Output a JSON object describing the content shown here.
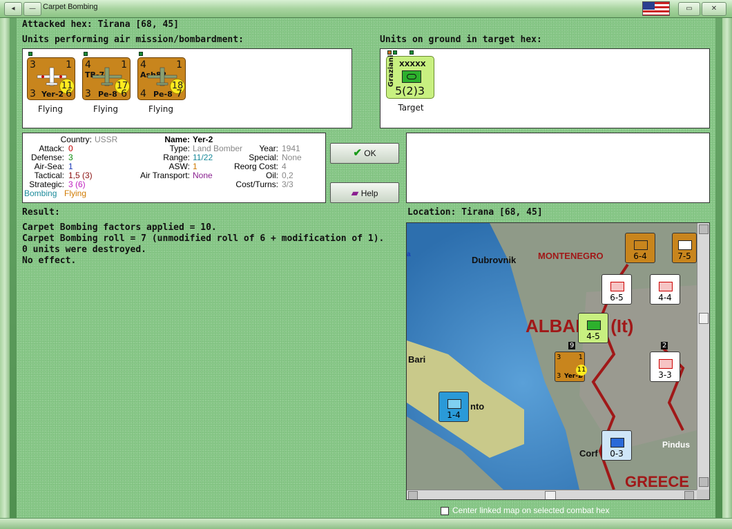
{
  "window": {
    "title": "Carpet Bombing"
  },
  "header": {
    "attacked_hex": "Attacked hex: Tirana [68, 45]",
    "air_units_label": "Units performing air mission/bombardment:",
    "ground_units_label": "Units on ground in target hex:"
  },
  "air_units": [
    {
      "attack": "3",
      "defense": "1",
      "name": "Yer-2",
      "range": "11",
      "tactical": "3",
      "strategic": "6",
      "subname": "",
      "status": "Flying"
    },
    {
      "attack": "4",
      "defense": "1",
      "name": "Pe-8",
      "range": "17",
      "tactical": "3",
      "strategic": "6",
      "subname": "TB-7",
      "status": "Flying"
    },
    {
      "attack": "4",
      "defense": "1",
      "name": "Pe-8",
      "range": "18",
      "tactical": "4",
      "strategic": "7",
      "subname": "Ash82",
      "status": "Flying"
    }
  ],
  "ground_units": [
    {
      "commander": "Graziani",
      "size": "XXXXX",
      "value": "5(2)3",
      "status": "Target"
    }
  ],
  "unit_info": {
    "country_label": "Country:",
    "country": "USSR",
    "attack_label": "Attack:",
    "attack": "0",
    "defense_label": "Defense:",
    "defense": "3",
    "airsea_label": "Air-Sea:",
    "airsea": "1",
    "tactical_label": "Tactical:",
    "tactical": "1,5 (3)",
    "strategic_label": "Strategic:",
    "strategic": "3 (6)",
    "mission": "Bombing",
    "status": "Flying",
    "name_label": "Name:",
    "name": "Yer-2",
    "type_label": "Type:",
    "type": "Land Bomber",
    "range_label": "Range:",
    "range": "11/22",
    "asw_label": "ASW:",
    "asw": "1",
    "air_transport_label": "Air Transport:",
    "air_transport": "None",
    "year_label": "Year:",
    "year": "1941",
    "special_label": "Special:",
    "special": "None",
    "reorg_label": "Reorg Cost:",
    "reorg": "4",
    "oil_label": "Oil:",
    "oil": "0,2",
    "cost_label": "Cost/Turns:",
    "cost": "3/3"
  },
  "buttons": {
    "ok": "OK",
    "help": "Help"
  },
  "result": {
    "label": "Result:",
    "lines": [
      "Carpet Bombing factors applied = 10.",
      "Carpet Bombing roll = 7 (unmodified roll of 6 + modification of 1).",
      "0 units were destroyed.",
      "No effect."
    ]
  },
  "location": {
    "label": "Location: Tirana [68, 45]"
  },
  "map": {
    "places": [
      "Dubrovnik",
      "MONTENEGRO",
      "ALBANIA (It)",
      "Bari",
      "nto",
      "Corf",
      "Pindus",
      "GREECE",
      "a"
    ],
    "counters": [
      {
        "value": "6-4"
      },
      {
        "value": "7-5"
      },
      {
        "value": "6-5"
      },
      {
        "value": "4-4"
      },
      {
        "value": "4-5"
      },
      {
        "value": "3-3"
      },
      {
        "value": "1-4"
      },
      {
        "value": "0-3"
      },
      {
        "value": "11"
      },
      {
        "value": "9"
      },
      {
        "value": "2"
      }
    ],
    "map_air": {
      "attack": "3",
      "defense": "1",
      "name": "Yer-2",
      "tac": "3",
      "str": "6"
    }
  },
  "footer": {
    "center_map": "Center linked map on selected combat hex"
  },
  "colors": {
    "panel_green": "#89c989",
    "counter_orange": "#c8851d",
    "ussr_grey": "#888888",
    "value_red": "#c00000",
    "value_green": "#0a8a0a",
    "value_blue": "#1a3ab8",
    "value_magenta": "#c020c0",
    "value_teal": "#1a8a9a",
    "value_orange": "#d07a00",
    "value_purple": "#8a2090"
  }
}
